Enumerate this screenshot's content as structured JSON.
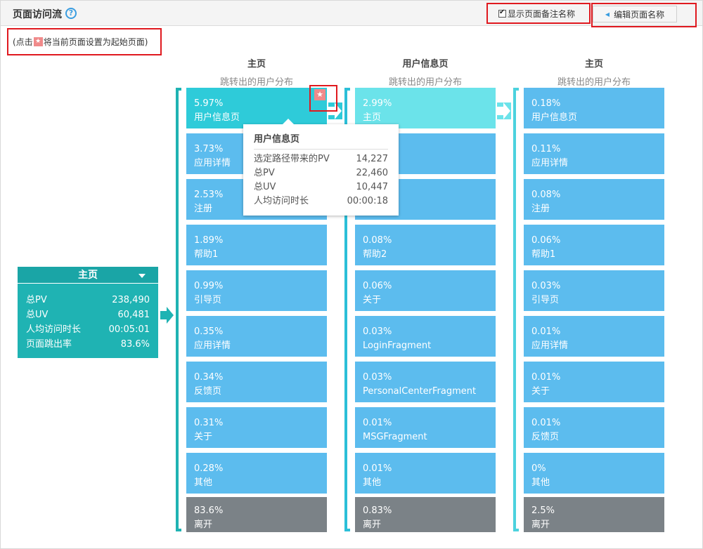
{
  "header": {
    "title": "页面访问流",
    "help_icon": "?",
    "show_note_label": "显示页面备注名称",
    "edit_button_label": "编辑页面名称"
  },
  "hint": {
    "prefix": "(点击",
    "suffix": "将当前页面设置为起始页面)"
  },
  "source": {
    "name": "主页",
    "stats": [
      {
        "label": "总PV",
        "value": "238,490"
      },
      {
        "label": "总UV",
        "value": "60,481"
      },
      {
        "label": "人均访问时长",
        "value": "00:05:01"
      },
      {
        "label": "页面跳出率",
        "value": "83.6%"
      }
    ]
  },
  "columns": [
    {
      "name": "主页",
      "subtitle": "跳转出的用户分布",
      "items": [
        {
          "pct": "5.97%",
          "label": "用户信息页"
        },
        {
          "pct": "3.73%",
          "label": "应用详情"
        },
        {
          "pct": "2.53%",
          "label": "注册"
        },
        {
          "pct": "1.89%",
          "label": "帮助1"
        },
        {
          "pct": "0.99%",
          "label": "引导页"
        },
        {
          "pct": "0.35%",
          "label": "应用详情"
        },
        {
          "pct": "0.34%",
          "label": "反馈页"
        },
        {
          "pct": "0.31%",
          "label": "关于"
        },
        {
          "pct": "0.28%",
          "label": "其他"
        },
        {
          "pct": "83.6%",
          "label": "离开"
        }
      ]
    },
    {
      "name": "用户信息页",
      "subtitle": "跳转出的用户分布",
      "items": [
        {
          "pct": "2.99%",
          "label": "主页"
        },
        {
          "pct": "",
          "label": ""
        },
        {
          "pct": "",
          "label": ""
        },
        {
          "pct": "0.08%",
          "label": "帮助2"
        },
        {
          "pct": "0.06%",
          "label": "关于"
        },
        {
          "pct": "0.03%",
          "label": "LoginFragment"
        },
        {
          "pct": "0.03%",
          "label": "PersonalCenterFragment"
        },
        {
          "pct": "0.01%",
          "label": "MSGFragment"
        },
        {
          "pct": "0.01%",
          "label": "其他"
        },
        {
          "pct": "0.83%",
          "label": "离开"
        }
      ]
    },
    {
      "name": "主页",
      "subtitle": "跳转出的用户分布",
      "items": [
        {
          "pct": "0.18%",
          "label": "用户信息页"
        },
        {
          "pct": "0.11%",
          "label": "应用详情"
        },
        {
          "pct": "0.08%",
          "label": "注册"
        },
        {
          "pct": "0.06%",
          "label": "帮助1"
        },
        {
          "pct": "0.03%",
          "label": "引导页"
        },
        {
          "pct": "0.01%",
          "label": "应用详情"
        },
        {
          "pct": "0.01%",
          "label": "关于"
        },
        {
          "pct": "0.01%",
          "label": "反馈页"
        },
        {
          "pct": "0%",
          "label": "其他"
        },
        {
          "pct": "2.5%",
          "label": "离开"
        }
      ]
    }
  ],
  "tooltip": {
    "title": "用户信息页",
    "rows": [
      {
        "label": "选定路径带来的PV",
        "value": "14,227"
      },
      {
        "label": "总PV",
        "value": "22,460"
      },
      {
        "label": "总UV",
        "value": "10,447"
      },
      {
        "label": "人均访问时长",
        "value": "00:00:18"
      }
    ]
  },
  "colors": {
    "cell": "#5cbcee",
    "exit": "#7b8287",
    "selected": "#2ecbd9",
    "source": "#1fb3b3",
    "highlight_box": "#e0191f"
  }
}
